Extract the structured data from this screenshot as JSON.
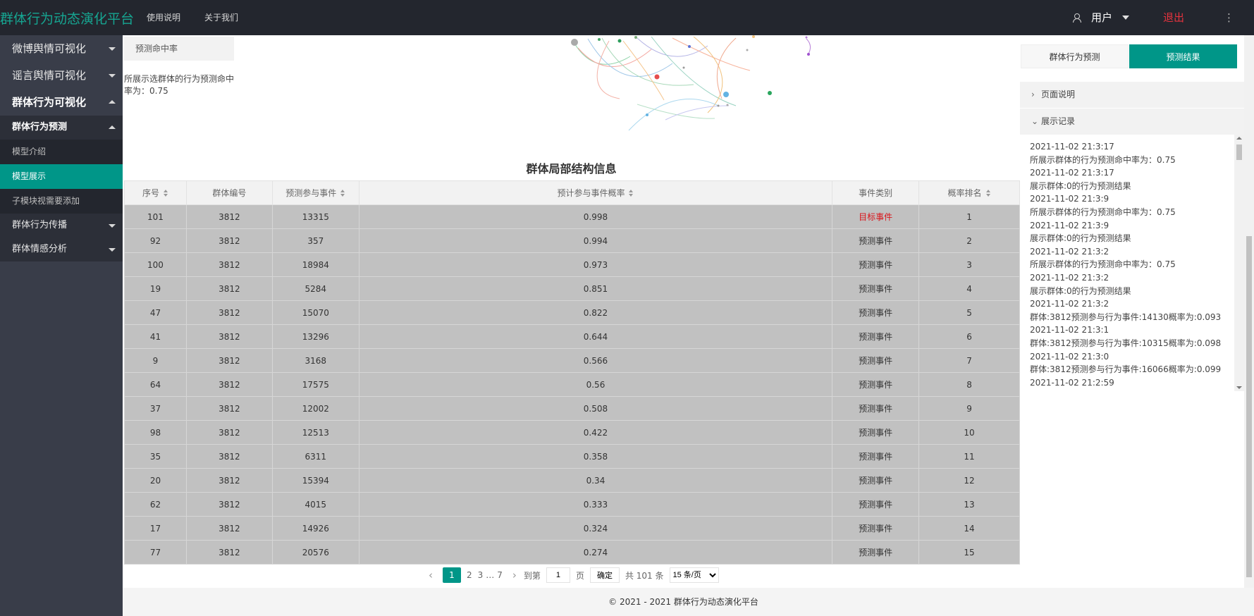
{
  "header": {
    "brand": "群体行为动态演化平台",
    "nav": [
      "使用说明",
      "关于我们"
    ],
    "user": "用户",
    "logout": "退出",
    "more": "⋮"
  },
  "sidebar": {
    "items": [
      {
        "label": "微博舆情可视化"
      },
      {
        "label": "谣言舆情可视化"
      },
      {
        "label": "群体行为可视化"
      }
    ],
    "sub": {
      "predict": "群体行为预测",
      "children": [
        "模型介绍",
        "模型展示",
        "子模块视需要添加"
      ],
      "spread": "群体行为传播",
      "emotion": "群体情感分析"
    }
  },
  "main": {
    "hit_card": "预测命中率",
    "hit_text": "所展示选群体的行为预测命中率为：0.75",
    "table_title": "群体局部结构信息",
    "columns": [
      "序号",
      "群体编号",
      "预测参与事件",
      "预计参与事件概率",
      "事件类别",
      "概率排名"
    ],
    "rows": [
      [
        "101",
        "3812",
        "13315",
        "0.998",
        "目标事件",
        "1"
      ],
      [
        "92",
        "3812",
        "357",
        "0.994",
        "预测事件",
        "2"
      ],
      [
        "100",
        "3812",
        "18984",
        "0.973",
        "预测事件",
        "3"
      ],
      [
        "19",
        "3812",
        "5284",
        "0.851",
        "预测事件",
        "4"
      ],
      [
        "47",
        "3812",
        "15070",
        "0.822",
        "预测事件",
        "5"
      ],
      [
        "41",
        "3812",
        "13296",
        "0.644",
        "预测事件",
        "6"
      ],
      [
        "9",
        "3812",
        "3168",
        "0.566",
        "预测事件",
        "7"
      ],
      [
        "64",
        "3812",
        "17575",
        "0.56",
        "预测事件",
        "8"
      ],
      [
        "37",
        "3812",
        "12002",
        "0.508",
        "预测事件",
        "9"
      ],
      [
        "98",
        "3812",
        "12513",
        "0.422",
        "预测事件",
        "10"
      ],
      [
        "35",
        "3812",
        "6311",
        "0.358",
        "预测事件",
        "11"
      ],
      [
        "20",
        "3812",
        "15394",
        "0.34",
        "预测事件",
        "12"
      ],
      [
        "62",
        "3812",
        "4015",
        "0.333",
        "预测事件",
        "13"
      ],
      [
        "17",
        "3812",
        "14926",
        "0.324",
        "预测事件",
        "14"
      ],
      [
        "77",
        "3812",
        "20576",
        "0.274",
        "预测事件",
        "15"
      ]
    ],
    "pager": {
      "pages": [
        "1",
        "2",
        "3",
        "…",
        "7"
      ],
      "goto": "到第",
      "goto_value": "1",
      "page_unit": "页",
      "confirm": "确定",
      "total": "共 101 条",
      "page_size": "15 条/页"
    }
  },
  "right": {
    "tabs": [
      "群体行为预测",
      "预测结果"
    ],
    "page_desc": "页面说明",
    "records": "展示记录",
    "log": [
      "2021-11-02 21:3:17",
      "所展示群体的行为预测命中率为：0.75",
      "2021-11-02 21:3:17",
      "展示群体:0的行为预测结果",
      "2021-11-02 21:3:9",
      "所展示群体的行为预测命中率为：0.75",
      "2021-11-02 21:3:9",
      "展示群体:0的行为预测结果",
      "2021-11-02 21:3:2",
      "所展示群体的行为预测命中率为：0.75",
      "2021-11-02 21:3:2",
      "展示群体:0的行为预测结果",
      "2021-11-02 21:3:2",
      "群体:3812预测参与行为事件:14130概率为:0.093",
      "2021-11-02 21:3:1",
      "群体:3812预测参与行为事件:10315概率为:0.098",
      "2021-11-02 21:3:0",
      "群体:3812预测参与行为事件:16066概率为:0.099",
      "2021-11-02 21:2:59"
    ]
  },
  "footer": "© 2021 - 2021 群体行为动态演化平台"
}
